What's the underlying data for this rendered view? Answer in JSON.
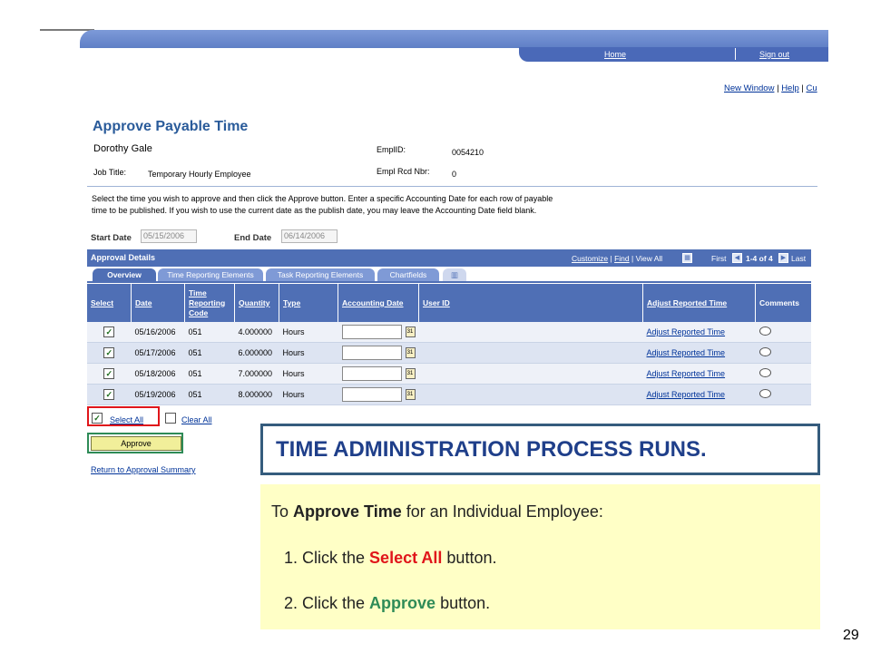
{
  "nav": {
    "home": "Home",
    "sign_out": "Sign out"
  },
  "top_links": {
    "new_window": "New Window",
    "help": "Help",
    "cu": "Cu"
  },
  "page": {
    "title": "Approve Payable Time",
    "employee_name": "Dorothy Gale",
    "job_title_label": "Job Title:",
    "job_title": "Temporary Hourly Employee",
    "emplid_label": "EmplID:",
    "emplid": "0054210",
    "empl_rcd_label": "Empl Rcd Nbr:",
    "empl_rcd": "0",
    "instructions_1": "Select the time you wish to approve and then click the Approve button.  Enter a specific Accounting Date for each row of payable",
    "instructions_2": "time to be published.  If you wish to use the current date as the publish date, you may leave the Accounting Date field blank.",
    "start_date_label": "Start Date",
    "start_date": "05/15/2006",
    "end_date_label": "End Date",
    "end_date": "06/14/2006"
  },
  "grid": {
    "title": "Approval Details",
    "customize": "Customize",
    "find": "Find",
    "view_all": "View All",
    "first": "First",
    "range": "1-4 of 4",
    "last": "Last",
    "tabs": [
      "Overview",
      "Time Reporting Elements",
      "Task Reporting Elements",
      "Chartfields"
    ],
    "columns": {
      "select": "Select",
      "date": "Date",
      "trc_1": "Time",
      "trc_2": "Reporting",
      "trc_3": "Code",
      "quantity": "Quantity",
      "type": "Type",
      "accounting_date": "Accounting Date",
      "user_id": "User ID",
      "adjust": "Adjust Reported Time",
      "comments": "Comments"
    },
    "rows": [
      {
        "date": "05/16/2006",
        "code": "051",
        "quantity": "4.000000",
        "type": "Hours",
        "adjust": "Adjust Reported Time"
      },
      {
        "date": "05/17/2006",
        "code": "051",
        "quantity": "6.000000",
        "type": "Hours",
        "adjust": "Adjust Reported Time"
      },
      {
        "date": "05/18/2006",
        "code": "051",
        "quantity": "7.000000",
        "type": "Hours",
        "adjust": "Adjust Reported Time"
      },
      {
        "date": "05/19/2006",
        "code": "051",
        "quantity": "8.000000",
        "type": "Hours",
        "adjust": "Adjust Reported Time"
      }
    ]
  },
  "actions": {
    "select_all": "Select All",
    "clear_all": "Clear All",
    "approve": "Approve",
    "return_link": "Return to Approval Summary"
  },
  "callout": {
    "banner": "TIME ADMINISTRATION PROCESS RUNS.",
    "intro_pre": "To ",
    "intro_bold": "Approve Time",
    "intro_post": " for an Individual Employee:",
    "step1_pre": "1. Click the ",
    "step1_key": "Select All",
    "step1_post": " button.",
    "step2_pre": "2. Click the ",
    "step2_key": "Approve",
    "step2_post": " button."
  },
  "slide_number": "29",
  "colors": {
    "accent_blue": "#4f6fb5",
    "select_highlight": "#e0151a",
    "approve_highlight": "#2e8b57",
    "callout_bg": "#ffffc6"
  }
}
